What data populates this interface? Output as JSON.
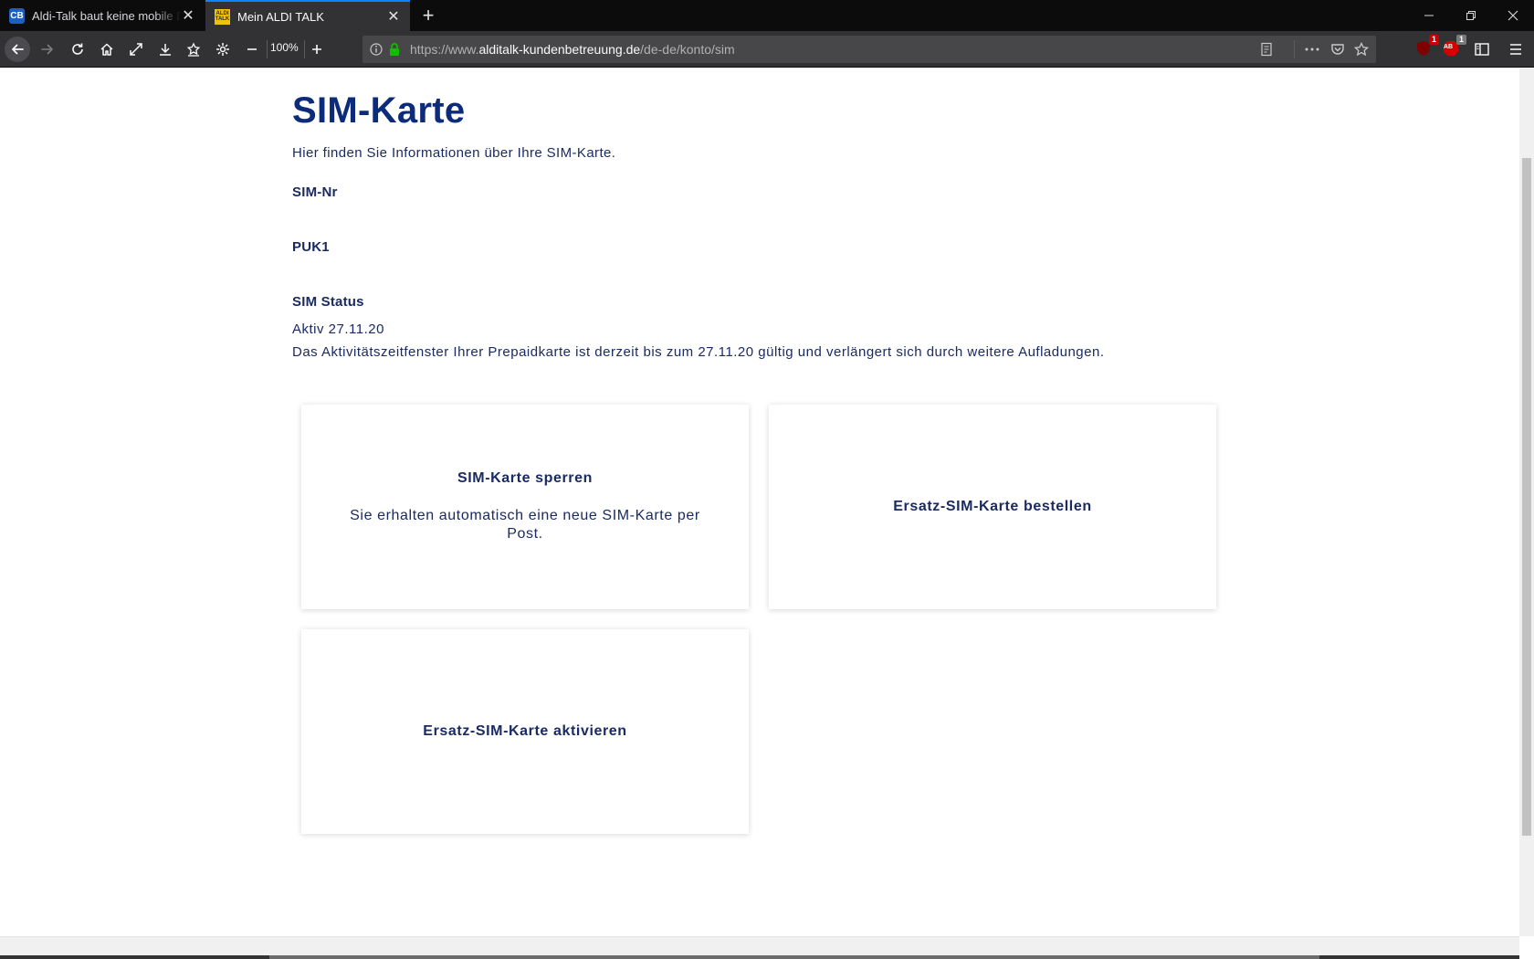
{
  "browser": {
    "tabs": [
      {
        "title": "Aldi-Talk baut keine mobile Daten auf",
        "favicon": "cb-favicon",
        "active": false
      },
      {
        "title": "Mein ALDI TALK",
        "favicon": "aldi-talk-favicon",
        "active": true
      }
    ],
    "favicon_cb_text": "CB",
    "favicon_aldi_text": "ALDI TALK",
    "zoom": "100%",
    "url": {
      "prefix": "https://www.",
      "host": "alditalk-kundenbetreuung.de",
      "path": "/de-de/konto/sim"
    },
    "extensions": [
      {
        "icon": "ublock-icon",
        "badge": "1"
      },
      {
        "icon": "adblock-icon",
        "badge": "1",
        "text": "AB"
      }
    ]
  },
  "page": {
    "title": "SIM-Karte",
    "intro": "Hier finden Sie Informationen über Ihre SIM-Karte.",
    "sim_nr_label": "SIM-Nr",
    "puk1_label": "PUK1",
    "sim_status_label": "SIM Status",
    "sim_status_value": "Aktiv 27.11.20",
    "sim_status_note": "Das Aktivitätszeitfenster Ihrer Prepaidkarte ist derzeit bis zum 27.11.20 gültig und verlängert sich durch weitere Aufladungen.",
    "cards": [
      {
        "title": "SIM-Karte sperren",
        "text": "Sie erhalten automatisch eine neue SIM-Karte per Post."
      },
      {
        "title": "Ersatz-SIM-Karte bestellen",
        "text": ""
      },
      {
        "title": "Ersatz-SIM-Karte aktivieren",
        "text": ""
      }
    ]
  },
  "colors": {
    "brand_dark_blue": "#0d2b7b",
    "text_blue": "#1a2b63",
    "chrome_bg": "#0c0c0d",
    "toolbar_bg": "#323234",
    "tab_accent": "#0a84ff",
    "secure_lock": "#12bc00"
  }
}
